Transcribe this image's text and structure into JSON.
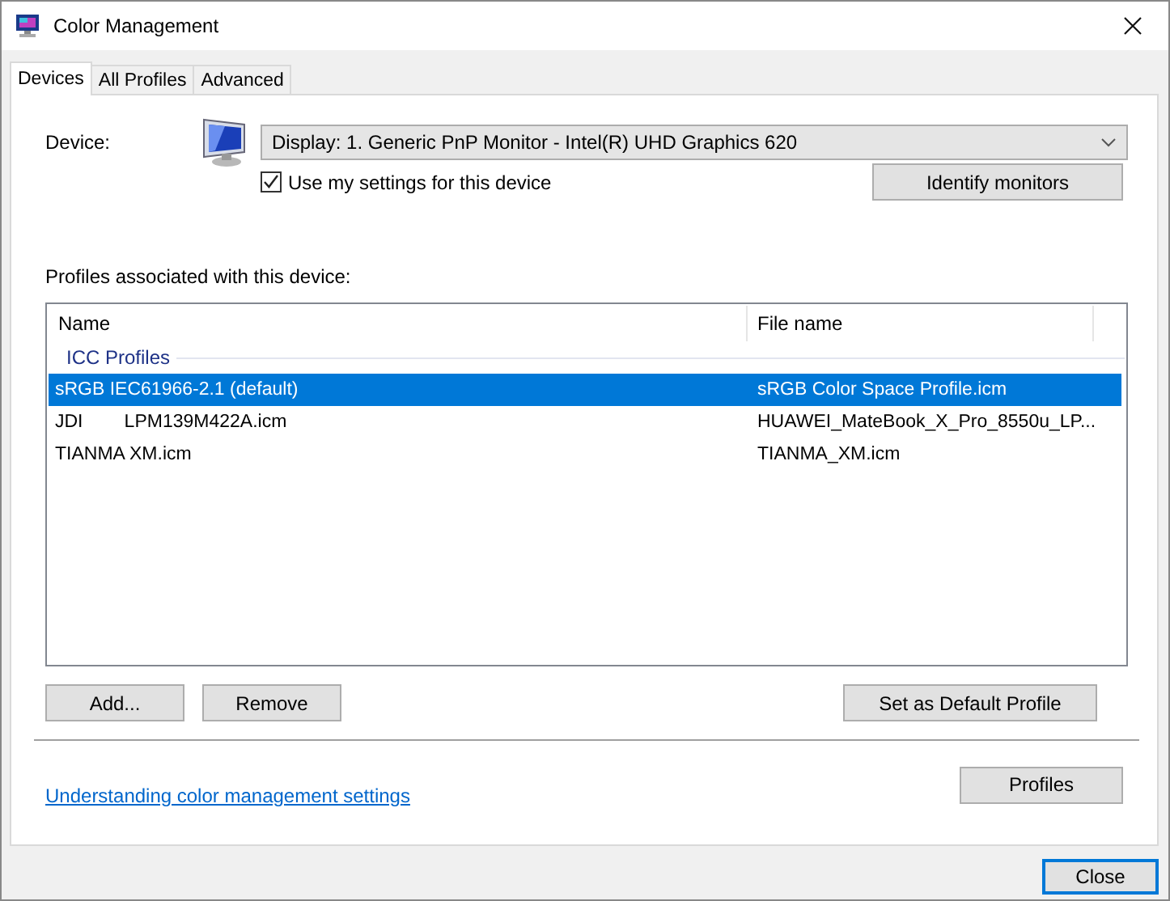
{
  "window": {
    "title": "Color Management"
  },
  "tabs": [
    {
      "label": "Devices",
      "selected": true
    },
    {
      "label": "All Profiles",
      "selected": false
    },
    {
      "label": "Advanced",
      "selected": false
    }
  ],
  "device": {
    "label": "Device:",
    "value": "Display: 1. Generic PnP Monitor - Intel(R) UHD Graphics 620",
    "use_my_settings": {
      "label": "Use my settings for this device",
      "checked": true
    },
    "identify_button": "Identify monitors"
  },
  "profiles": {
    "label": "Profiles associated with this device:",
    "columns": [
      "Name",
      "File name"
    ],
    "group": "ICC Profiles",
    "rows": [
      {
        "name": "sRGB IEC61966-2.1 (default)",
        "file": "sRGB Color Space Profile.icm",
        "selected": true
      },
      {
        "name": "JDI        LPM139M422A.icm",
        "file": "HUAWEI_MateBook_X_Pro_8550u_LP...",
        "selected": false
      },
      {
        "name": "TIANMA XM.icm",
        "file": "TIANMA_XM.icm",
        "selected": false
      }
    ],
    "buttons": [
      "Add...",
      "Remove",
      "Set as Default Profile"
    ]
  },
  "link": "Understanding color management settings",
  "profiles_button": "Profiles",
  "close_button": "Close"
}
